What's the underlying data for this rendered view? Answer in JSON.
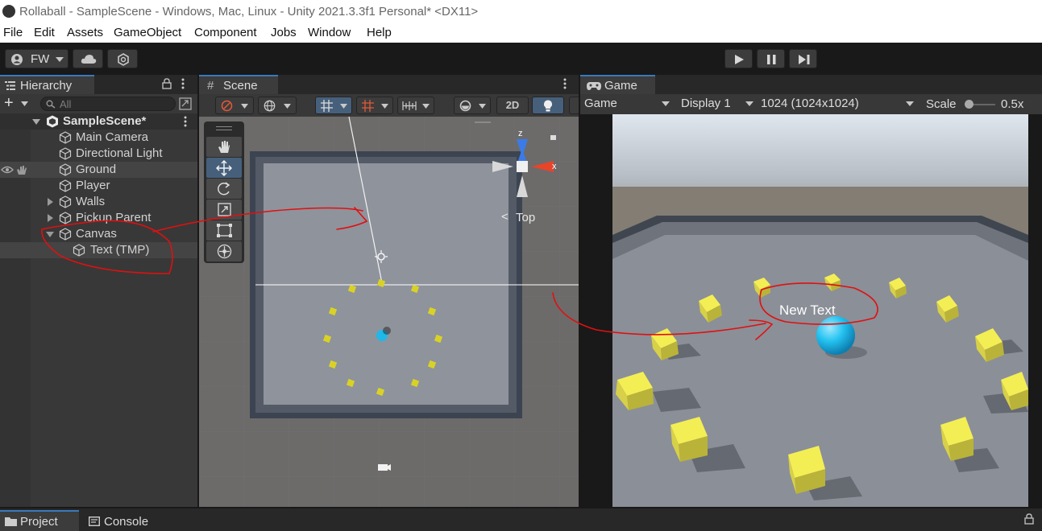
{
  "window": {
    "title": "Rollaball - SampleScene - Windows, Mac, Linux - Unity 2021.3.3f1 Personal* <DX11>"
  },
  "menu": [
    "File",
    "Edit",
    "Assets",
    "GameObject",
    "Component",
    "Jobs",
    "Window",
    "Help"
  ],
  "toolbar": {
    "account": "FW"
  },
  "hierarchy": {
    "tab_label": "Hierarchy",
    "search_placeholder": "All",
    "add_symbol": "+",
    "scene_name": "SampleScene*",
    "items": [
      {
        "label": "Main Camera"
      },
      {
        "label": "Directional Light"
      },
      {
        "label": "Ground"
      },
      {
        "label": "Player"
      },
      {
        "label": "Walls"
      },
      {
        "label": "Pickup Parent"
      },
      {
        "label": "Canvas"
      },
      {
        "label": "Text (TMP)"
      }
    ]
  },
  "scene": {
    "tab_label": "Scene",
    "mode_2d": "2D",
    "gizmo_axes": {
      "z": "z",
      "x": "x"
    },
    "view_label": "Top"
  },
  "game": {
    "tab_label": "Game",
    "view_dropdown": "Game",
    "display_dropdown": "Display 1",
    "resolution_dropdown": "1024 (1024x1024)",
    "scale_label": "Scale",
    "scale_value": "0.5x",
    "canvas_text": "New Text"
  },
  "bottom": {
    "project_tab": "Project",
    "console_tab": "Console"
  },
  "colors": {
    "accent_blue": "#3a79bb",
    "annotation_red": "#e01010",
    "pickup_yellow": "#e8e03a",
    "player_cyan": "#1fb8e8"
  }
}
